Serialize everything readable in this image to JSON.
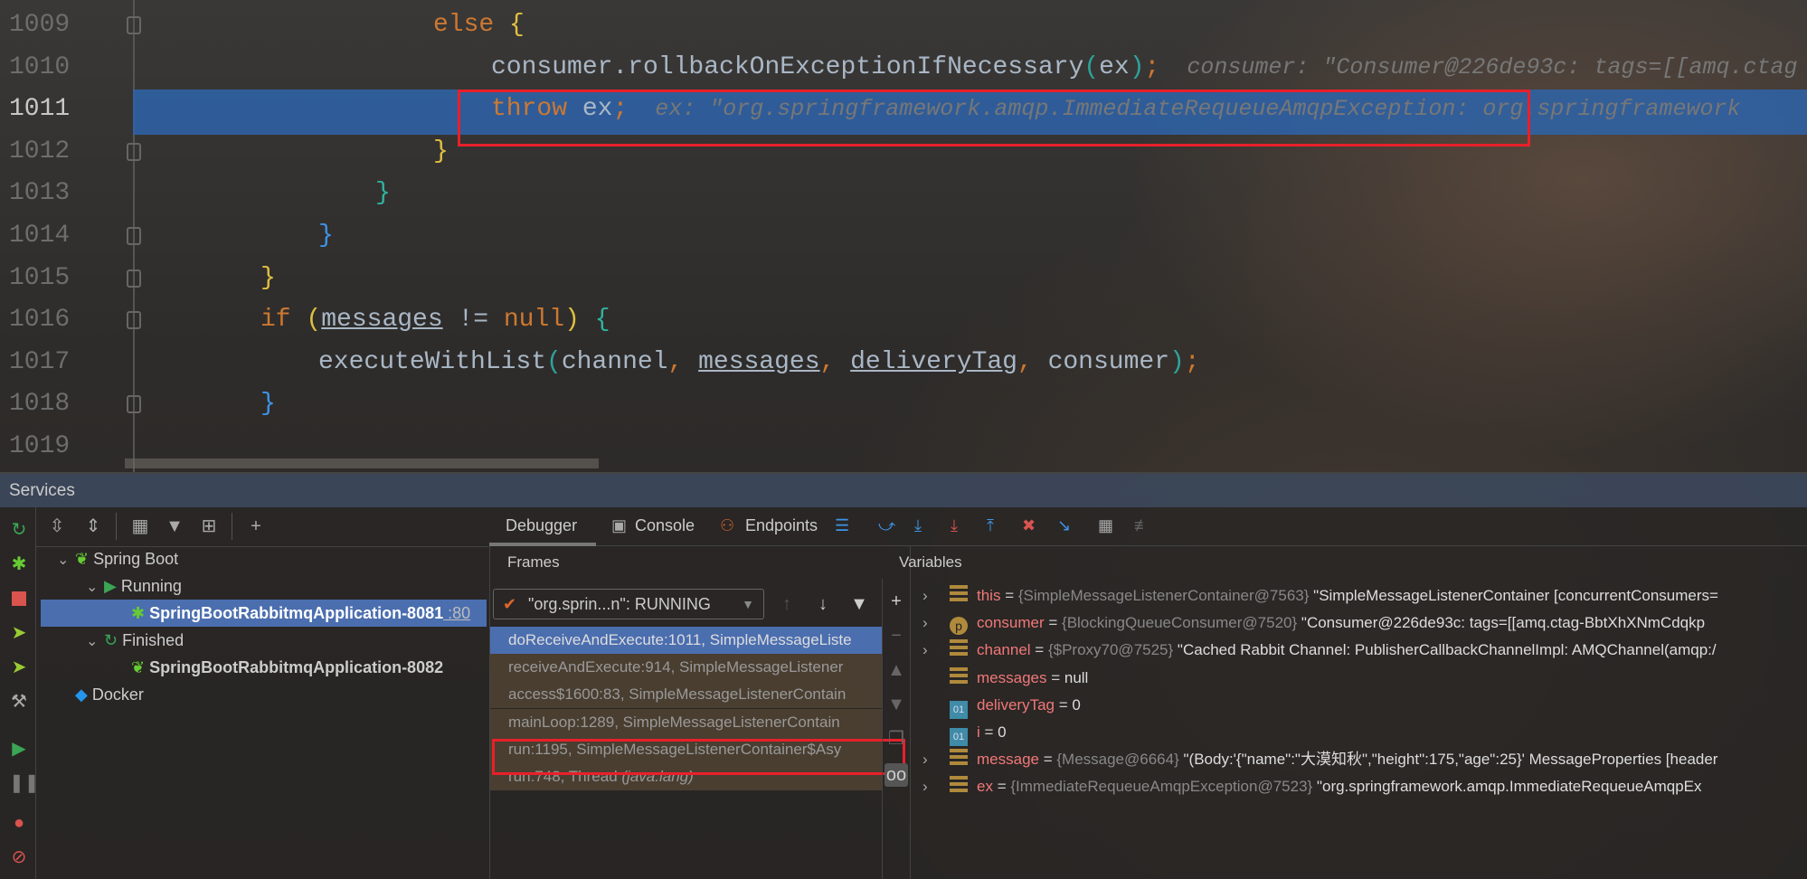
{
  "editor": {
    "line_numbers": [
      "1009",
      "1010",
      "1011",
      "1012",
      "1013",
      "1014",
      "1015",
      "1016",
      "1017",
      "1018",
      "1019"
    ],
    "current_line": "1011",
    "lines": [
      [
        {
          "t": "else ",
          "k": "kw"
        },
        {
          "t": "{",
          "k": "brace-y"
        }
      ],
      [
        {
          "t": "consumer.rollbackOnExceptionIfNecessary",
          "k": "id"
        },
        {
          "t": "(",
          "k": "par1"
        },
        {
          "t": "ex",
          "k": "id"
        },
        {
          "t": ")",
          "k": "par1"
        },
        {
          "t": ";",
          "k": "punc"
        },
        {
          "t": "  consumer: \"Consumer@226de93c: tags=[[amq.ctag",
          "k": "hint"
        }
      ],
      [
        {
          "t": "throw ",
          "k": "kw"
        },
        {
          "t": "ex",
          "k": "id"
        },
        {
          "t": ";",
          "k": "punc"
        },
        {
          "t": "  ex: \"org.springframework.amqp.ImmediateRequeueAmqpException: org.springframework",
          "k": "hint"
        }
      ],
      [
        {
          "t": "}",
          "k": "brace-y"
        }
      ],
      [
        {
          "t": "}",
          "k": "brace-t"
        }
      ],
      [
        {
          "t": "}",
          "k": "brace-b"
        }
      ],
      [
        {
          "t": "}",
          "k": "brace-y"
        }
      ],
      [
        {
          "t": "if ",
          "k": "kw"
        },
        {
          "t": "(",
          "k": "brace-y"
        },
        {
          "t": "messages",
          "k": "var"
        },
        {
          "t": " != ",
          "k": "id"
        },
        {
          "t": "null",
          "k": "kw"
        },
        {
          "t": ") ",
          "k": "brace-y"
        },
        {
          "t": "{",
          "k": "brace-t"
        }
      ],
      [
        {
          "t": "executeWithList",
          "k": "id"
        },
        {
          "t": "(",
          "k": "par1"
        },
        {
          "t": "channel",
          "k": "id"
        },
        {
          "t": ", ",
          "k": "punc"
        },
        {
          "t": "messages",
          "k": "var"
        },
        {
          "t": ", ",
          "k": "punc"
        },
        {
          "t": "deliveryTag",
          "k": "var"
        },
        {
          "t": ", ",
          "k": "punc"
        },
        {
          "t": "consumer",
          "k": "id"
        },
        {
          "t": ")",
          "k": "par1"
        },
        {
          "t": ";",
          "k": "punc"
        }
      ],
      [
        {
          "t": "}",
          "k": "brace-b"
        }
      ],
      []
    ]
  },
  "services": {
    "title": "Services",
    "tree": [
      {
        "label": "Spring Boot",
        "icon": "spring-boot-icon",
        "expanded": true
      },
      {
        "label": "Running",
        "icon": "run-icon",
        "expanded": true
      },
      {
        "label": "SpringBootRabbitmqApplication-8081",
        "suffix": " :80",
        "icon": "debug-bug-icon",
        "selected": true
      },
      {
        "label": "Finished",
        "icon": "rerun-icon",
        "expanded": true
      },
      {
        "label": "SpringBootRabbitmqApplication-8082",
        "icon": "spring-boot-icon"
      },
      {
        "label": "Docker",
        "icon": "docker-icon"
      }
    ]
  },
  "debugger": {
    "tabs": [
      "Debugger",
      "Console",
      "Endpoints"
    ],
    "active_tab": "Debugger",
    "frames_title": "Frames",
    "variables_title": "Variables",
    "thread_select": "\"org.sprin...n\": RUNNING",
    "frames": [
      {
        "method": "doReceiveAndExecute:1011, SimpleMessageListe",
        "pkg": ""
      },
      {
        "method": "receiveAndExecute:914, SimpleMessageListener",
        "pkg": ""
      },
      {
        "method": "access$1600:83, SimpleMessageListenerContain",
        "pkg": ""
      },
      {
        "method": "mainLoop:1289, SimpleMessageListenerContain",
        "pkg": ""
      },
      {
        "method": "run:1195, SimpleMessageListenerContainer$Asy",
        "pkg": ""
      },
      {
        "method": "run:748, Thread ",
        "pkg": "(java.lang)"
      }
    ],
    "variables": [
      {
        "name": "this",
        "icon": "f",
        "type": "{SimpleMessageListenerContainer@7563}",
        "value": "\"SimpleMessageListenerContainer [concurrentConsumers=",
        "expandable": true
      },
      {
        "name": "consumer",
        "icon": "p",
        "type": "{BlockingQueueConsumer@7520}",
        "value": "\"Consumer@226de93c: tags=[[amq.ctag-BbtXhXNmCdqkp",
        "expandable": true
      },
      {
        "name": "channel",
        "icon": "f",
        "type": "{$Proxy70@7525}",
        "value": "\"Cached Rabbit Channel: PublisherCallbackChannelImpl: AMQChannel(amqp:/",
        "expandable": true
      },
      {
        "name": "messages",
        "icon": "f",
        "type": "",
        "value": "null",
        "expandable": false
      },
      {
        "name": "deliveryTag",
        "icon": "n",
        "type": "",
        "value": "0",
        "expandable": false
      },
      {
        "name": "i",
        "icon": "n",
        "type": "",
        "value": "0",
        "expandable": false
      },
      {
        "name": "message",
        "icon": "f",
        "type": "{Message@6664}",
        "value": "\"(Body:'{\"name\":\"大漠知秋\",\"height\":175,\"age\":25}' MessageProperties [header",
        "expandable": true
      },
      {
        "name": "ex",
        "icon": "f",
        "type": "{ImmediateRequeueAmqpException@7523}",
        "value": "\"org.springframework.amqp.ImmediateRequeueAmqpEx",
        "expandable": true
      }
    ]
  },
  "colors": {
    "selection": "#4b6eaf",
    "highlight_box": "#e8202a",
    "keyword": "#cc7832",
    "var_name": "#f07878"
  }
}
